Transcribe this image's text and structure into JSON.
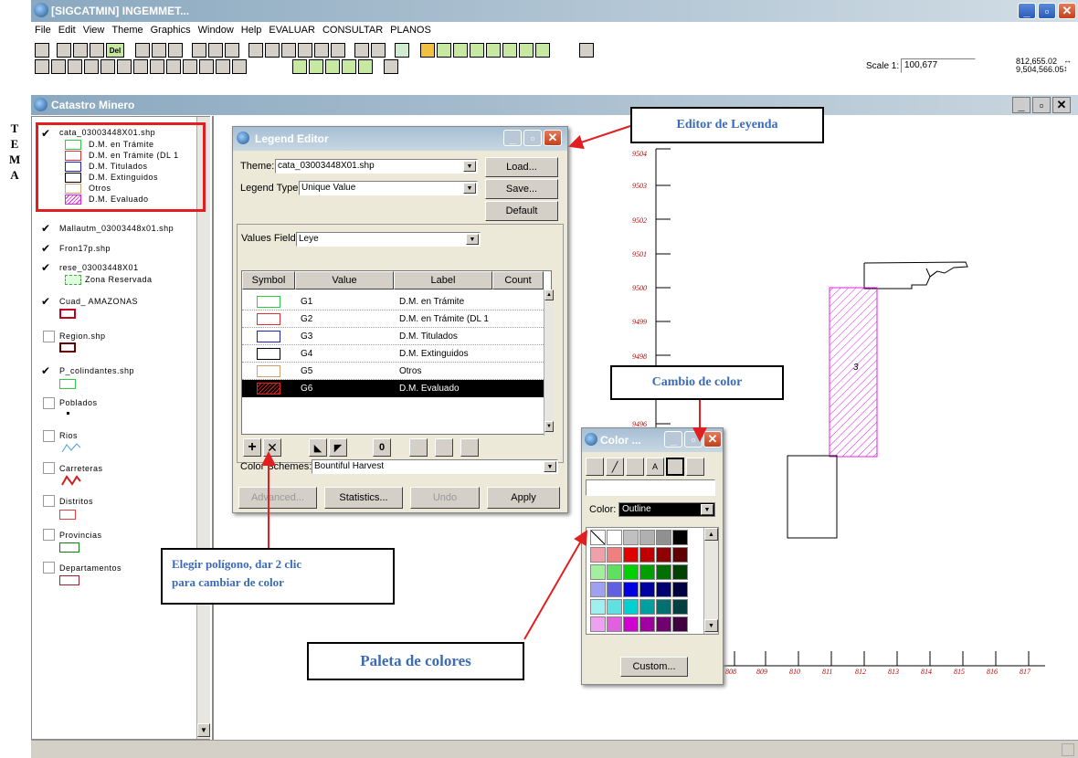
{
  "app": {
    "title": "[SIGCATMIN] INGEMMET...",
    "icon": "globe-icon"
  },
  "menu": [
    "File",
    "Edit",
    "View",
    "Theme",
    "Graphics",
    "Window",
    "Help",
    "EVALUAR",
    "CONSULTAR",
    "PLANOS"
  ],
  "scale": {
    "label": "Scale 1:",
    "value": "100,677",
    "coord_x": "812,655.02",
    "coord_y": "9,504,566.05"
  },
  "view_window": {
    "title": "Catastro Minero"
  },
  "side_label": [
    "T",
    "E",
    "M",
    "A"
  ],
  "toc": {
    "theme1": {
      "name": "cata_03003448X01.shp",
      "classes": [
        "D.M. en Trámite",
        "D.M. en Trámite (DL 1",
        "D.M. Titulados",
        "D.M. Extinguidos",
        "Otros",
        "D.M. Evaluado"
      ]
    },
    "theme2": "Mallautm_03003448x01.shp",
    "theme3": "Fron17p.shp",
    "theme4": {
      "name": "rese_03003448X01",
      "legend": "Zona Reservada"
    },
    "theme5": "Cuad_ AMAZONAS",
    "theme6": "Region.shp",
    "theme7": "P_colindantes.shp",
    "theme8": "Poblados",
    "theme9": "Rios",
    "theme10": "Carreteras",
    "theme11": "Distritos",
    "theme12": "Provincias",
    "theme13": "Departamentos"
  },
  "legend_editor": {
    "title": "Legend Editor",
    "theme_label": "Theme:",
    "theme_value": "cata_03003448X01.shp",
    "type_label": "Legend Type:",
    "type_value": "Unique Value",
    "load": "Load...",
    "save": "Save...",
    "default": "Default",
    "values_field_label": "Values Field:",
    "values_field_value": "Leye",
    "columns": [
      "Symbol",
      "Value",
      "Label",
      "Count"
    ],
    "rows": [
      {
        "value": "G1",
        "label": "D.M. en Trámite",
        "color": "#2ecc40"
      },
      {
        "value": "G2",
        "label": "D.M. en Trámite (DL 1",
        "color": "#e03030"
      },
      {
        "value": "G3",
        "label": "D.M. Titulados",
        "color": "#2020c0"
      },
      {
        "value": "G4",
        "label": "D.M. Extinguidos",
        "color": "#000000"
      },
      {
        "value": "G5",
        "label": "Otros",
        "color": "#d4a070"
      },
      {
        "value": "G6",
        "label": "D.M. Evaluado",
        "color": "#e020e0"
      }
    ],
    "zero_btn": "0",
    "color_schemes_label": "Color Schemes:",
    "color_schemes_value": "Bountiful Harvest",
    "advanced": "Advanced...",
    "statistics": "Statistics...",
    "undo": "Undo",
    "apply": "Apply"
  },
  "color_window": {
    "title": "Color ...",
    "color_label": "Color:",
    "color_value": "Outline",
    "custom": "Custom..."
  },
  "annotations": {
    "editor_leyenda": "Editor de Leyenda",
    "cambio_color": "Cambio de color",
    "elegir_line1": "Elegir polígono, dar 2 clic",
    "elegir_line2": "para cambiar de color",
    "paleta": "Paleta de colores"
  },
  "map": {
    "y_labels": [
      "9504",
      "9503",
      "9502",
      "9501",
      "9500",
      "9499",
      "9498",
      "9497",
      "9496"
    ],
    "x_labels": [
      "808",
      "809",
      "810",
      "811",
      "812",
      "813",
      "814",
      "815",
      "816",
      "817"
    ],
    "polygon_label": "3"
  }
}
